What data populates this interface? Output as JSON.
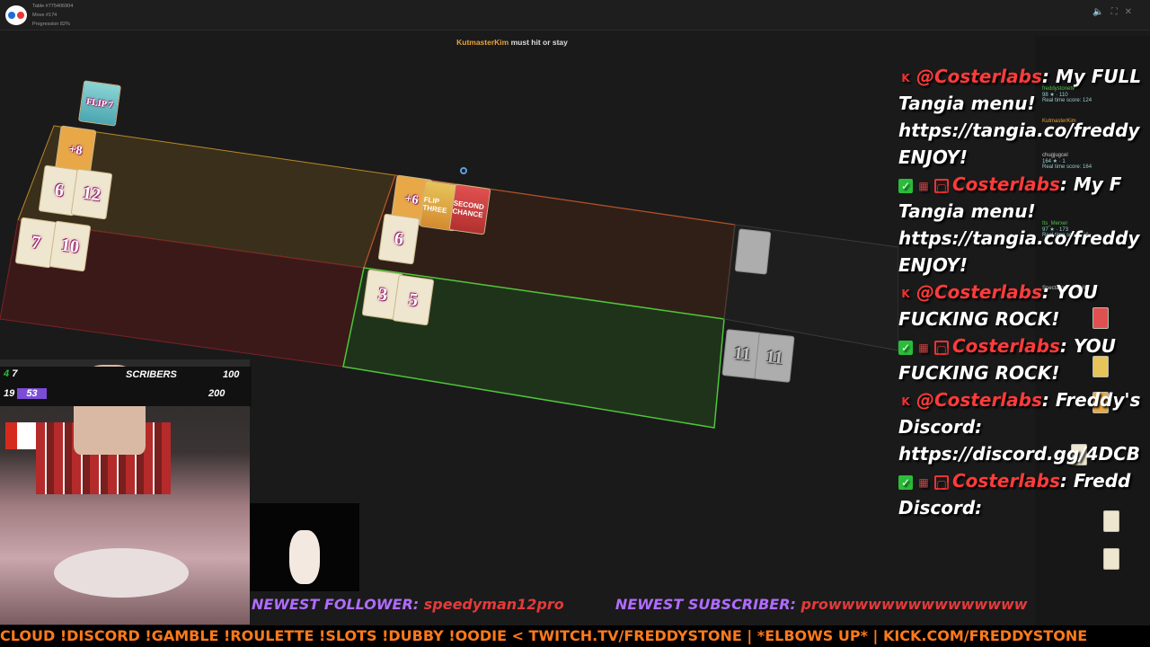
{
  "table_info": {
    "table": "Table #775406904",
    "move": "Move #174",
    "progression": "Progression 82%"
  },
  "status": {
    "player": "KutmasterKim",
    "message": "must hit or stay"
  },
  "players": [
    {
      "name": "freddystonetv",
      "meta": "98 ★ · 110",
      "score": "Real time score: 124"
    },
    {
      "name": "KutmasterKim",
      "meta": "",
      "score": ""
    },
    {
      "name": "chugjugcel",
      "meta": "164 ★ · 1",
      "score": "Real time score: 164"
    },
    {
      "name": "Its_Merxer",
      "meta": "97 ★ · 173",
      "score": "Real time score: 96"
    }
  ],
  "spectators_label": "Spectators:",
  "spectators_value": "dogkilla",
  "cards": {
    "p1_mod": "+8",
    "p1_a": "6",
    "p1_b": "12",
    "p1_c": "7",
    "p1_d": "10",
    "p2_mod": "+6",
    "p2_flip": "FLIP THREE",
    "p2_second": "SECOND CHANCE",
    "p2_a": "6",
    "p3_a": "3",
    "p3_b": "5",
    "grey_a": "11",
    "grey_b": "11",
    "deck_top": "FLIP 7"
  },
  "subs": {
    "label": "SCRIBERS",
    "goal1": "100",
    "goal2": "200",
    "count1": "4",
    "count2": "7",
    "count3": "19",
    "count4": "53"
  },
  "chat": [
    {
      "badges": [
        "K"
      ],
      "author": "@Costerlabs",
      "text": ": My FULL"
    },
    {
      "text": "Tangia menu!"
    },
    {
      "text": "https://tangia.co/freddy"
    },
    {
      "text": "ENJOY!"
    },
    {
      "badges": [
        "✓",
        "▦",
        "▢"
      ],
      "author": "Costerlabs",
      "text": ": My F"
    },
    {
      "text": "Tangia menu!"
    },
    {
      "text": "https://tangia.co/freddy"
    },
    {
      "text": "ENJOY!"
    },
    {
      "badges": [
        "K"
      ],
      "author": "@Costerlabs",
      "text": ": YOU"
    },
    {
      "text": "FUCKING ROCK!"
    },
    {
      "badges": [
        "✓",
        "▦",
        "▢"
      ],
      "author": "Costerlabs",
      "text": ": YOU"
    },
    {
      "text": "FUCKING ROCK!"
    },
    {
      "badges": [
        "K"
      ],
      "author": "@Costerlabs",
      "text": ": Freddy's"
    },
    {
      "text": "Discord:"
    },
    {
      "text": "https://discord.gg/4DCB"
    },
    {
      "badges": [
        "✓",
        "▦",
        "▢"
      ],
      "author": "Costerlabs",
      "text": ": Fredd"
    },
    {
      "text": "Discord:"
    }
  ],
  "banner": {
    "follower_label": "NEWEST FOLLOWER:",
    "follower_value": "speedyman12pro",
    "subscriber_label": "NEWEST SUBSCRIBER:",
    "subscriber_value": "prowwwwwwwwwwwwwww"
  },
  "ticker": "CLOUD !DISCORD !GAMBLE !ROULETTE !SLOTS !DUBBY !OODIE  < TWITCH.TV/FREDDYSTONE | *ELBOWS UP* | KICK.COM/FREDDYSTONE"
}
